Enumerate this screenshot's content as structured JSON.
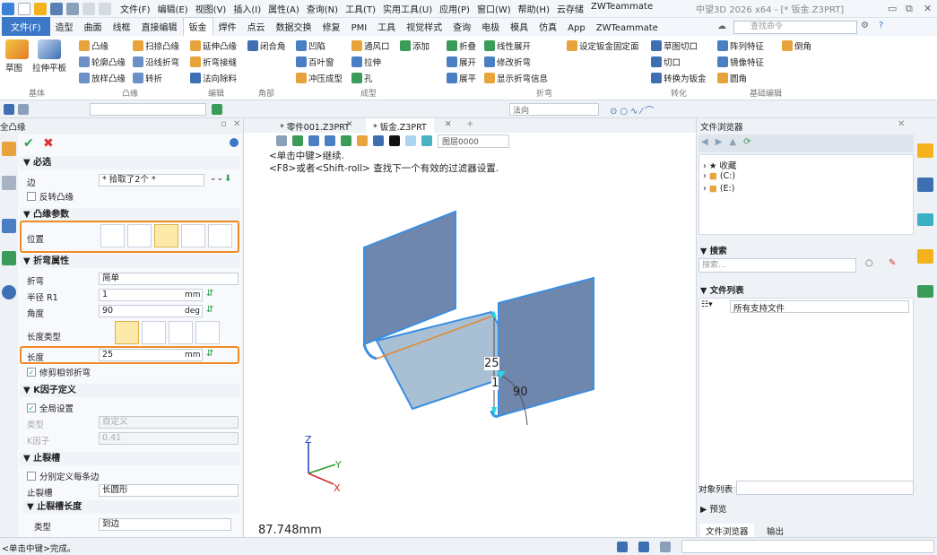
{
  "menubar": {
    "items": [
      "文件(F)",
      "编辑(E)",
      "视图(V)",
      "插入(I)",
      "属性(A)",
      "查询(N)",
      "工具(T)",
      "实用工具(U)",
      "应用(P)",
      "窗口(W)",
      "帮助(H)",
      "云存储",
      "ZWTeammate"
    ],
    "app_title": "中望3D 2026 x64 - [* 钣金.Z3PRT]"
  },
  "ribbon_tabs": [
    "文件(F)",
    "造型",
    "曲面",
    "线框",
    "直接编辑",
    "钣金",
    "焊件",
    "点云",
    "数据交换",
    "修复",
    "PMI",
    "工具",
    "视觉样式",
    "查询",
    "电极",
    "模具",
    "仿真",
    "App",
    "ZWTeammate"
  ],
  "active_tab": "钣金",
  "search_placeholder": "查找命令",
  "ribbon": {
    "basic": {
      "label": "基体",
      "draw": "草图",
      "flat": "拉伸平板"
    },
    "flange": {
      "label": "凸缘",
      "items": [
        "凸缘",
        "扫掠凸缘",
        "轮廓凸缘",
        "沿线折弯",
        "放样凸缘",
        "转折"
      ]
    },
    "edit": {
      "label": "编辑",
      "items": [
        "延伸凸缘",
        "折弯接缝",
        "法向除料"
      ]
    },
    "corner": {
      "label": "角部",
      "items": [
        "闭合角"
      ]
    },
    "form": {
      "label": "成型",
      "items": [
        "凹陷",
        "通风口",
        "添加",
        "百叶窗",
        "拉伸",
        "冲压成型",
        "孔"
      ]
    },
    "bend": {
      "label": "折弯",
      "items": [
        "折叠",
        "线性展开",
        "设定钣金固定面",
        "展开",
        "修改折弯",
        "展平",
        "显示折弯信息"
      ]
    },
    "convert": {
      "label": "转化",
      "items": [
        "草图切口",
        "切口",
        "转换为钣金"
      ]
    },
    "basic_edit": {
      "label": "基础编辑",
      "items": [
        "阵列特征",
        "倒角",
        "镜像特征",
        "圆角"
      ]
    }
  },
  "toolbar2": {
    "normal_field": "法向"
  },
  "left_panel": {
    "title": "全凸缘",
    "sections": {
      "required": "必选",
      "flange_params": "凸缘参数",
      "bend_props": "折弯属性",
      "k_factor": "K因子定义",
      "relief": "止裂槽",
      "relief_length": "止裂槽长度"
    },
    "edge_label": "边",
    "edge_value": "* 拾取了2个 *",
    "reverse_flange": "反转凸缘",
    "position_label": "位置",
    "bend_label": "折弯",
    "bend_value": "简单",
    "radius_label": "半径 R1",
    "radius_value": "1",
    "radius_unit": "mm",
    "angle_label": "角度",
    "angle_value": "90",
    "angle_unit": "deg",
    "length_type_label": "长度类型",
    "length_label": "长度",
    "length_value": "25",
    "length_unit": "mm",
    "trim_adjacent": "修剪相邻折弯",
    "global_setting": "全局设置",
    "type_label": "类型",
    "type_value": "自定义",
    "k_label": "K因子",
    "k_value": "0.41",
    "define_each": "分别定义每条边",
    "relief_label": "止裂槽",
    "relief_value": "长圆形",
    "relief_type_label": "类型",
    "relief_type_value": "到边"
  },
  "doc_tabs": [
    "* 零件001.Z3PRT",
    "* 钣金.Z3PRT"
  ],
  "viewport": {
    "layer": "图层0000",
    "hint1": "<单击中键>继续.",
    "hint2": "<F8>或者<Shift-roll> 查找下一个有效的过滤器设置.",
    "dim_length": "25",
    "dim_radius": "1",
    "dim_angle": "90",
    "measure": "87.748mm",
    "axis_x": "X",
    "axis_y": "Y",
    "axis_z": "Z"
  },
  "right_panel": {
    "title": "文件浏览器",
    "tree": [
      "收藏",
      "(C:)",
      "(E:)"
    ],
    "search_section": "搜索",
    "search_placeholder": "搜索...",
    "file_list": "文件列表",
    "filter": "所有支持文件",
    "object_list": "对象列表",
    "preview": "预览",
    "bottom_tabs": [
      "文件浏览器",
      "输出"
    ]
  },
  "status": {
    "text": "<单击中键>完成。"
  },
  "colors": {
    "accent": "#3b78c8",
    "highlight": "#f08a24",
    "part_face": "#6f86ad",
    "part_floor": "#a9bfd4",
    "edge": "#3a8fe0"
  }
}
